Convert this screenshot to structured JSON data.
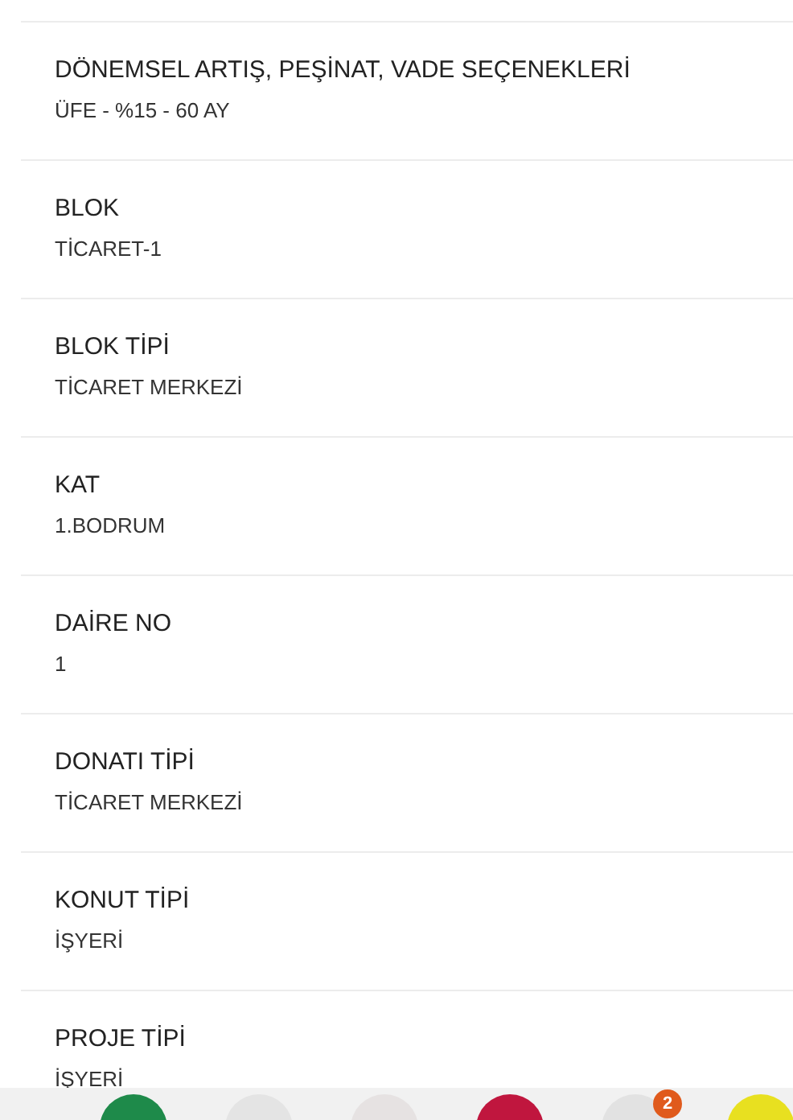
{
  "fields": [
    {
      "label": "DÖNEMSEL ARTIŞ, PEŞİNAT, VADE SEÇENEKLERİ",
      "value": "ÜFE - %15 - 60 AY"
    },
    {
      "label": "BLOK",
      "value": "TİCARET-1"
    },
    {
      "label": "BLOK TİPİ",
      "value": "TİCARET MERKEZİ"
    },
    {
      "label": "KAT",
      "value": "1.BODRUM"
    },
    {
      "label": "DAİRE NO",
      "value": "1"
    },
    {
      "label": "DONATI TİPİ",
      "value": "TİCARET MERKEZİ"
    },
    {
      "label": "KONUT TİPİ",
      "value": "İŞYERİ"
    },
    {
      "label": "PROJE TİPİ",
      "value": "İŞYERİ"
    }
  ],
  "dock": {
    "apps": [
      {
        "color": "#1e8a4a"
      },
      {
        "color": "#e4e4e4"
      },
      {
        "color": "#e6e2e2"
      },
      {
        "color": "#c0163e"
      },
      {
        "color": "#e2e2e2",
        "badge": "2"
      },
      {
        "color": "#e8e020"
      }
    ]
  }
}
